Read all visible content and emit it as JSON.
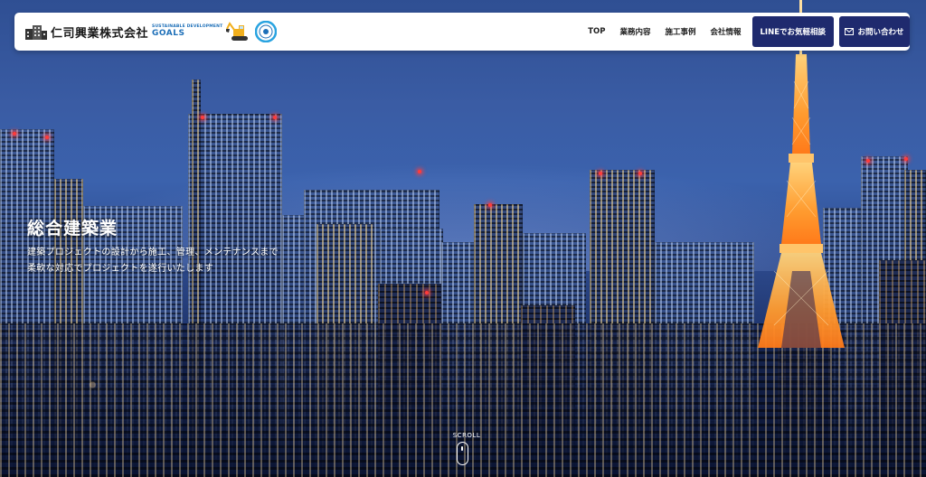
{
  "brand": {
    "company_name": "仁司興業株式会社",
    "sdg_line": "SUSTAINABLE DEVELOPMENT",
    "sdg_goals": "GOALS",
    "logo_icon": "building-logo-icon",
    "excavator_icon": "excavator-icon",
    "badge_icon": "sdgs-badge-icon"
  },
  "nav": {
    "items": [
      {
        "label": "TOP"
      },
      {
        "label": "業務内容"
      },
      {
        "label": "施工事例"
      },
      {
        "label": "会社情報"
      }
    ],
    "line_button": "LINEでお気軽相談",
    "contact_button": "お問い合わせ",
    "contact_icon": "mail-icon"
  },
  "hero": {
    "title": "総合建築業",
    "line1": "建築プロジェクトの設計から施工、管理、メンテナンスまで",
    "line2": "柔軟な対応でプロジェクトを遂行いたします",
    "background": "tokyo-night-skyline"
  },
  "scroll": {
    "label": "SCROLL",
    "icon": "mouse-scroll-icon"
  },
  "colors": {
    "accent": "#1f2a6e",
    "header_bg": "#ffffff",
    "hero_text": "#ffffff",
    "sdg_blue": "#1d6fb8"
  }
}
